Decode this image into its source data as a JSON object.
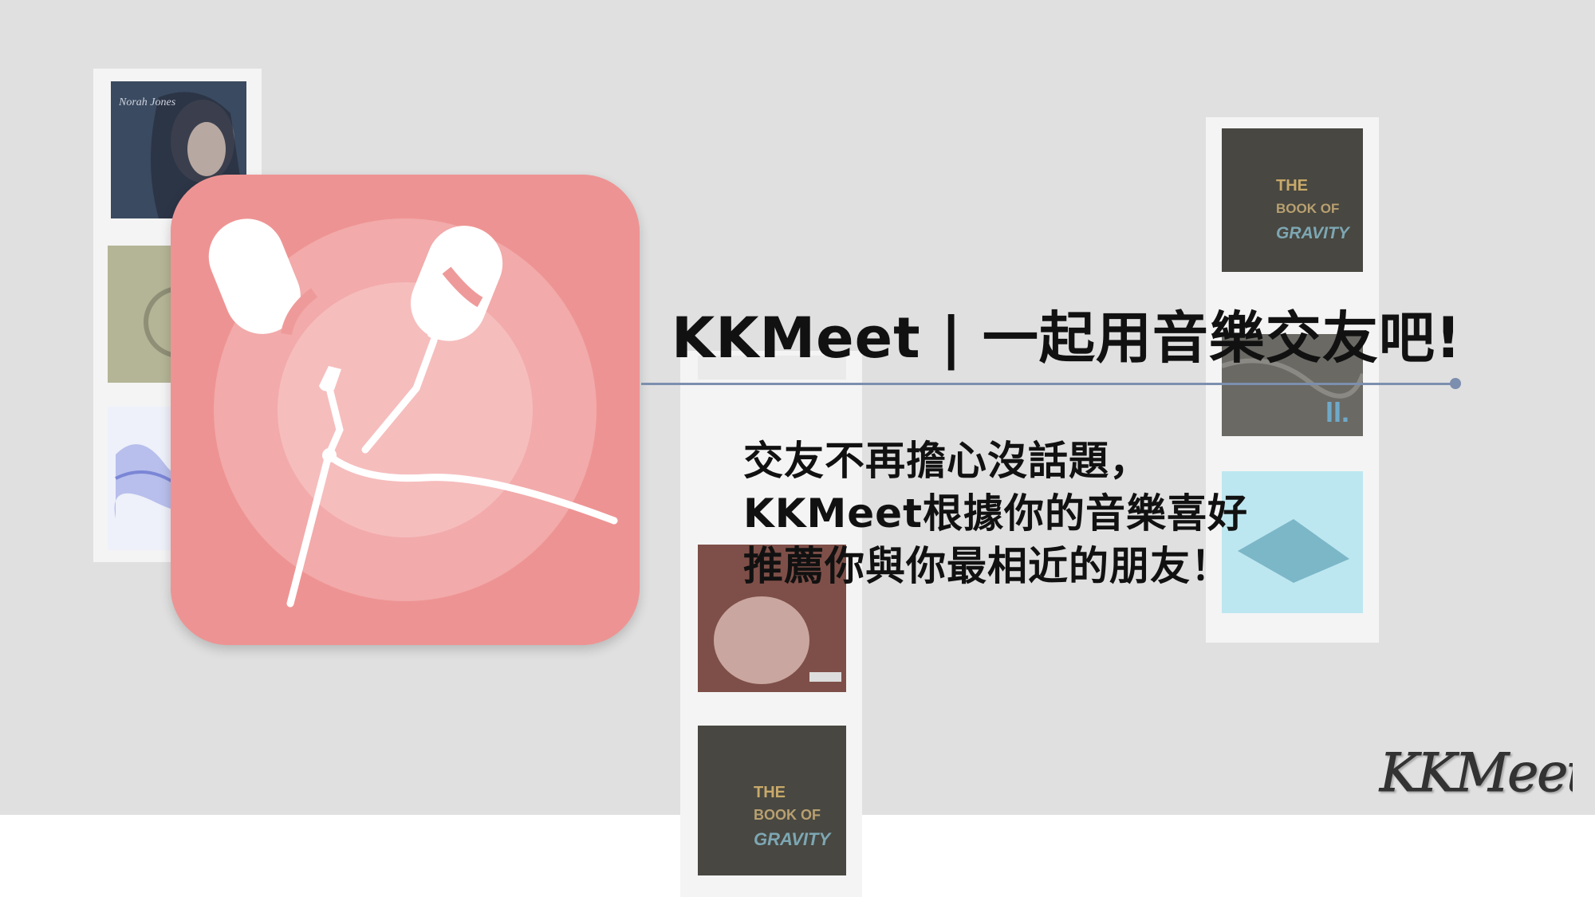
{
  "headline": "KKMeet | 一起用音樂交友吧!",
  "tagline": {
    "lines": [
      "交友不再擔心沒話題，",
      "KKMeet根據你的音樂喜好",
      "推薦你與你最相近的朋友！"
    ]
  },
  "logo": {
    "text": "KKMeet"
  },
  "album_covers": {
    "book_of_us": "THE BOOK OF US: GRAVITY",
    "norah_jones": "Norah Jones"
  },
  "colors": {
    "background": "#e0e0e0",
    "icon": "#ee9393",
    "divider": "#7c8fae",
    "text": "#111111"
  },
  "icons": {
    "app_icon": "earphones-icon",
    "logo": "kkmeet-logo"
  }
}
